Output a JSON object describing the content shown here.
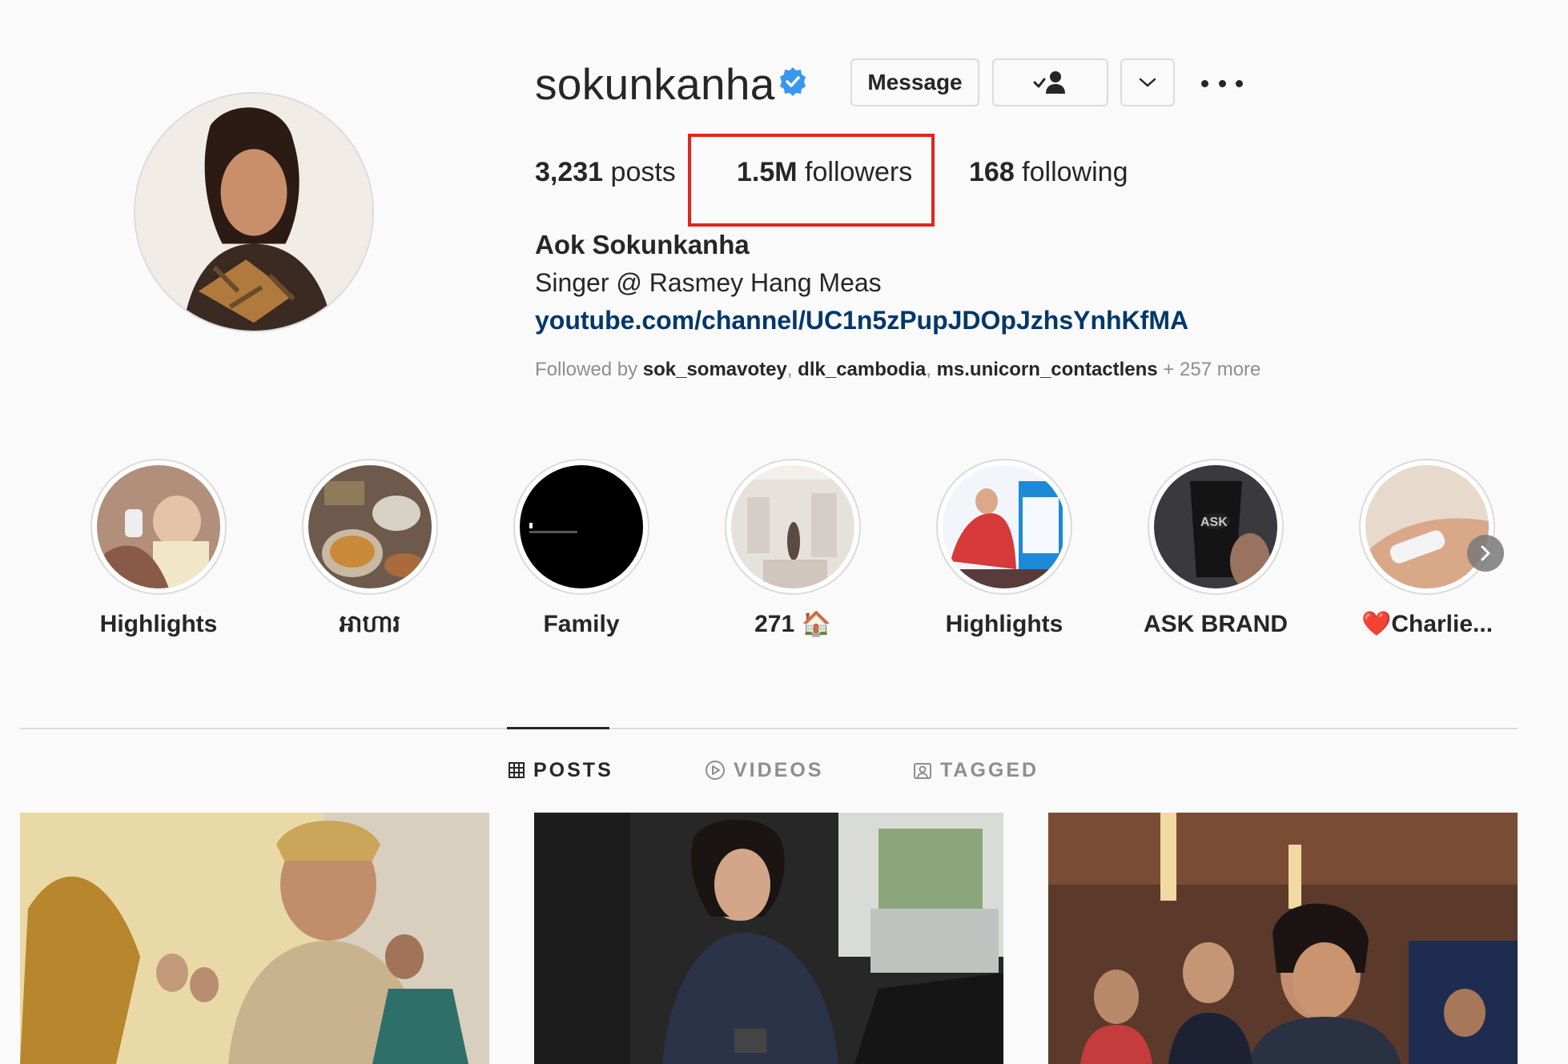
{
  "profile": {
    "username": "sokunkanha",
    "verified": true,
    "buttons": {
      "message": "Message"
    },
    "stats": {
      "posts_count": "3,231",
      "posts_label": " posts",
      "followers_count": "1.5M",
      "followers_label": " followers",
      "following_count": "168",
      "following_label": " following"
    },
    "full_name": "Aok Sokunkanha",
    "bio": "Singer @ Rasmey Hang Meas",
    "link": "youtube.com/channel/UC1n5zPupJDOpJzhsYnhKfMA",
    "followed_by": {
      "prefix": "Followed by ",
      "users": [
        "sok_somavotey",
        "dlk_cambodia",
        "ms.unicorn_contactlens"
      ],
      "separator": ", ",
      "suffix": " + 257 more"
    }
  },
  "highlights": [
    {
      "label": "Highlights"
    },
    {
      "label": "អាហារ"
    },
    {
      "label": "Family"
    },
    {
      "label": "271 🏠"
    },
    {
      "label": "Highlights"
    },
    {
      "label": "ASK BRAND"
    },
    {
      "label": "❤️Charlie..."
    }
  ],
  "tabs": {
    "posts": "POSTS",
    "videos": "VIDEOS",
    "tagged": "TAGGED"
  },
  "colors": {
    "background": "#fafafa",
    "verified_blue": "#3897f0",
    "link_blue": "#00376b",
    "annotation_red": "#e0261b",
    "muted_text": "#8e8e8e"
  },
  "icons": [
    "verified-badge-icon",
    "following-person-icon",
    "chevron-down-icon",
    "more-options-icon",
    "grid-icon",
    "play-circle-icon",
    "tagged-user-icon",
    "carousel-icon",
    "next-arrow-icon"
  ]
}
